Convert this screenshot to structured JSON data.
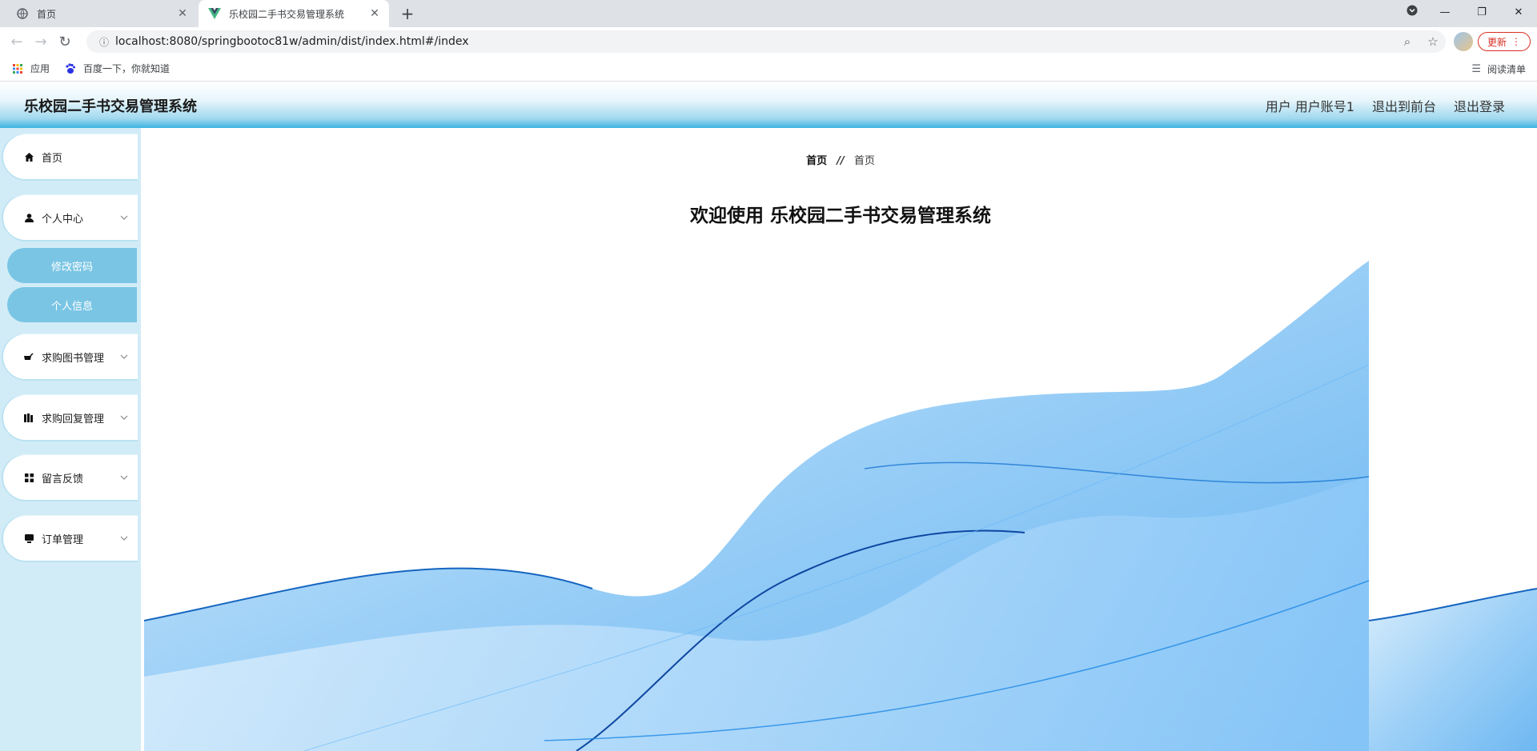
{
  "browser": {
    "tabs": [
      {
        "title": "首页",
        "active": false
      },
      {
        "title": "乐校园二手书交易管理系统",
        "active": true
      }
    ],
    "url": "localhost:8080/springbootoc81w/admin/dist/index.html#/index",
    "update_label": "更新",
    "bookmarks": [
      {
        "label": "应用",
        "icon": "apps-grid-icon"
      },
      {
        "label": "百度一下，你就知道",
        "icon": "baidu-paw-icon"
      }
    ],
    "reading_list_label": "阅读清单"
  },
  "header": {
    "title": "乐校园二手书交易管理系统",
    "user_label": "用户 用户账号1",
    "to_front_label": "退出到前台",
    "logout_label": "退出登录"
  },
  "sidebar": {
    "home": "首页",
    "personal_center": "个人中心",
    "sub_items": [
      "修改密码",
      "个人信息"
    ],
    "menus": [
      "求购图书管理",
      "求购回复管理",
      "留言反馈",
      "订单管理"
    ]
  },
  "main": {
    "breadcrumb_first": "首页",
    "breadcrumb_sep": "//",
    "breadcrumb_second": "首页",
    "welcome": "欢迎使用 乐校园二手书交易管理系统"
  },
  "colors": {
    "header_gradient_end": "#3cb3e0",
    "sidebar_bg": "#d2ecf7",
    "sub_item_bg": "#7ac5e4",
    "wave_blue": "#1e88e5"
  }
}
